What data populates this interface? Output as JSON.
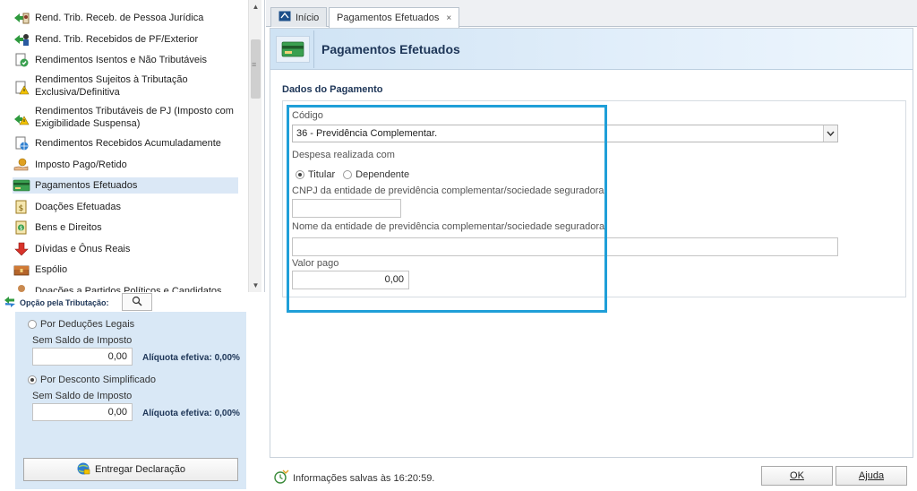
{
  "sidebar": {
    "items": [
      {
        "label": "Rend. Trib. Receb. de Pessoa Jurídica",
        "icon": "arrow-person-icon"
      },
      {
        "label": "Rend. Trib. Recebidos de PF/Exterior",
        "icon": "arrow-person-icon"
      },
      {
        "label": "Rendimentos Isentos e Não Tributáveis",
        "icon": "doc-check-icon"
      },
      {
        "label1": "Rendimentos Sujeitos à Tributação",
        "label2": "Exclusiva/Definitiva",
        "icon": "doc-warning-icon"
      },
      {
        "label1": "Rendimentos Tributáveis de PJ (Imposto com",
        "label2": "Exigibilidade Suspensa)",
        "icon": "arrow-warning-icon"
      },
      {
        "label": "Rendimentos Recebidos Acumuladamente",
        "icon": "doc-globe-icon"
      },
      {
        "label": "Imposto Pago/Retido",
        "icon": "hand-coin-icon"
      },
      {
        "label": "Pagamentos Efetuados",
        "icon": "card-icon",
        "selected": true
      },
      {
        "label": "Doações Efetuadas",
        "icon": "coin-doc-icon"
      },
      {
        "label": "Bens e Direitos",
        "icon": "coin-doc-icon"
      },
      {
        "label": "Dívidas e Ônus Reais",
        "icon": "down-arrow-icon"
      },
      {
        "label": "Espólio",
        "icon": "chest-icon"
      },
      {
        "label": "Doações a Partidos Políticos e Candidatos",
        "icon": "person-icon"
      }
    ]
  },
  "tributacao": {
    "title": "Opção pela Tributação:",
    "deducoes_label": "Por Deduções Legais",
    "deducoes_selected": false,
    "deducoes_saldo": "Sem Saldo de Imposto",
    "deducoes_valor": "0,00",
    "deducoes_aliquota": "Alíquota efetiva: 0,00%",
    "simplificado_label": "Por Desconto Simplificado",
    "simplificado_selected": true,
    "simplificado_saldo": "Sem Saldo de Imposto",
    "simplificado_valor": "0,00",
    "simplificado_aliquota": "Alíquota efetiva: 0,00%",
    "entregar_label": "Entregar Declaração"
  },
  "tabs": [
    {
      "label": "Início",
      "active": false
    },
    {
      "label": "Pagamentos Efetuados",
      "active": true,
      "close": "×"
    }
  ],
  "page": {
    "title": "Pagamentos Efetuados",
    "section_title": "Dados do Pagamento"
  },
  "form": {
    "codigo_label": "Código",
    "codigo_value": "36 - Previdência Complementar.",
    "despesa_label": "Despesa realizada com",
    "titular_label": "Titular",
    "titular_selected": true,
    "dependente_label": "Dependente",
    "dependente_selected": false,
    "cnpj_label": "CNPJ da entidade de previdência complementar/sociedade seguradora",
    "cnpj_value": "",
    "nome_label": "Nome da entidade de previdência complementar/sociedade seguradora",
    "nome_value": "",
    "valor_label": "Valor pago",
    "valor_value": "0,00"
  },
  "status": {
    "message": "Informações salvas às 16:20:59.",
    "ok_label": "OK",
    "ajuda_label": "Ajuda"
  },
  "colors": {
    "accent": "#1f9fd8",
    "title": "#1d3557",
    "selection": "#dbe8f6",
    "panel": "#d9e8f6"
  }
}
